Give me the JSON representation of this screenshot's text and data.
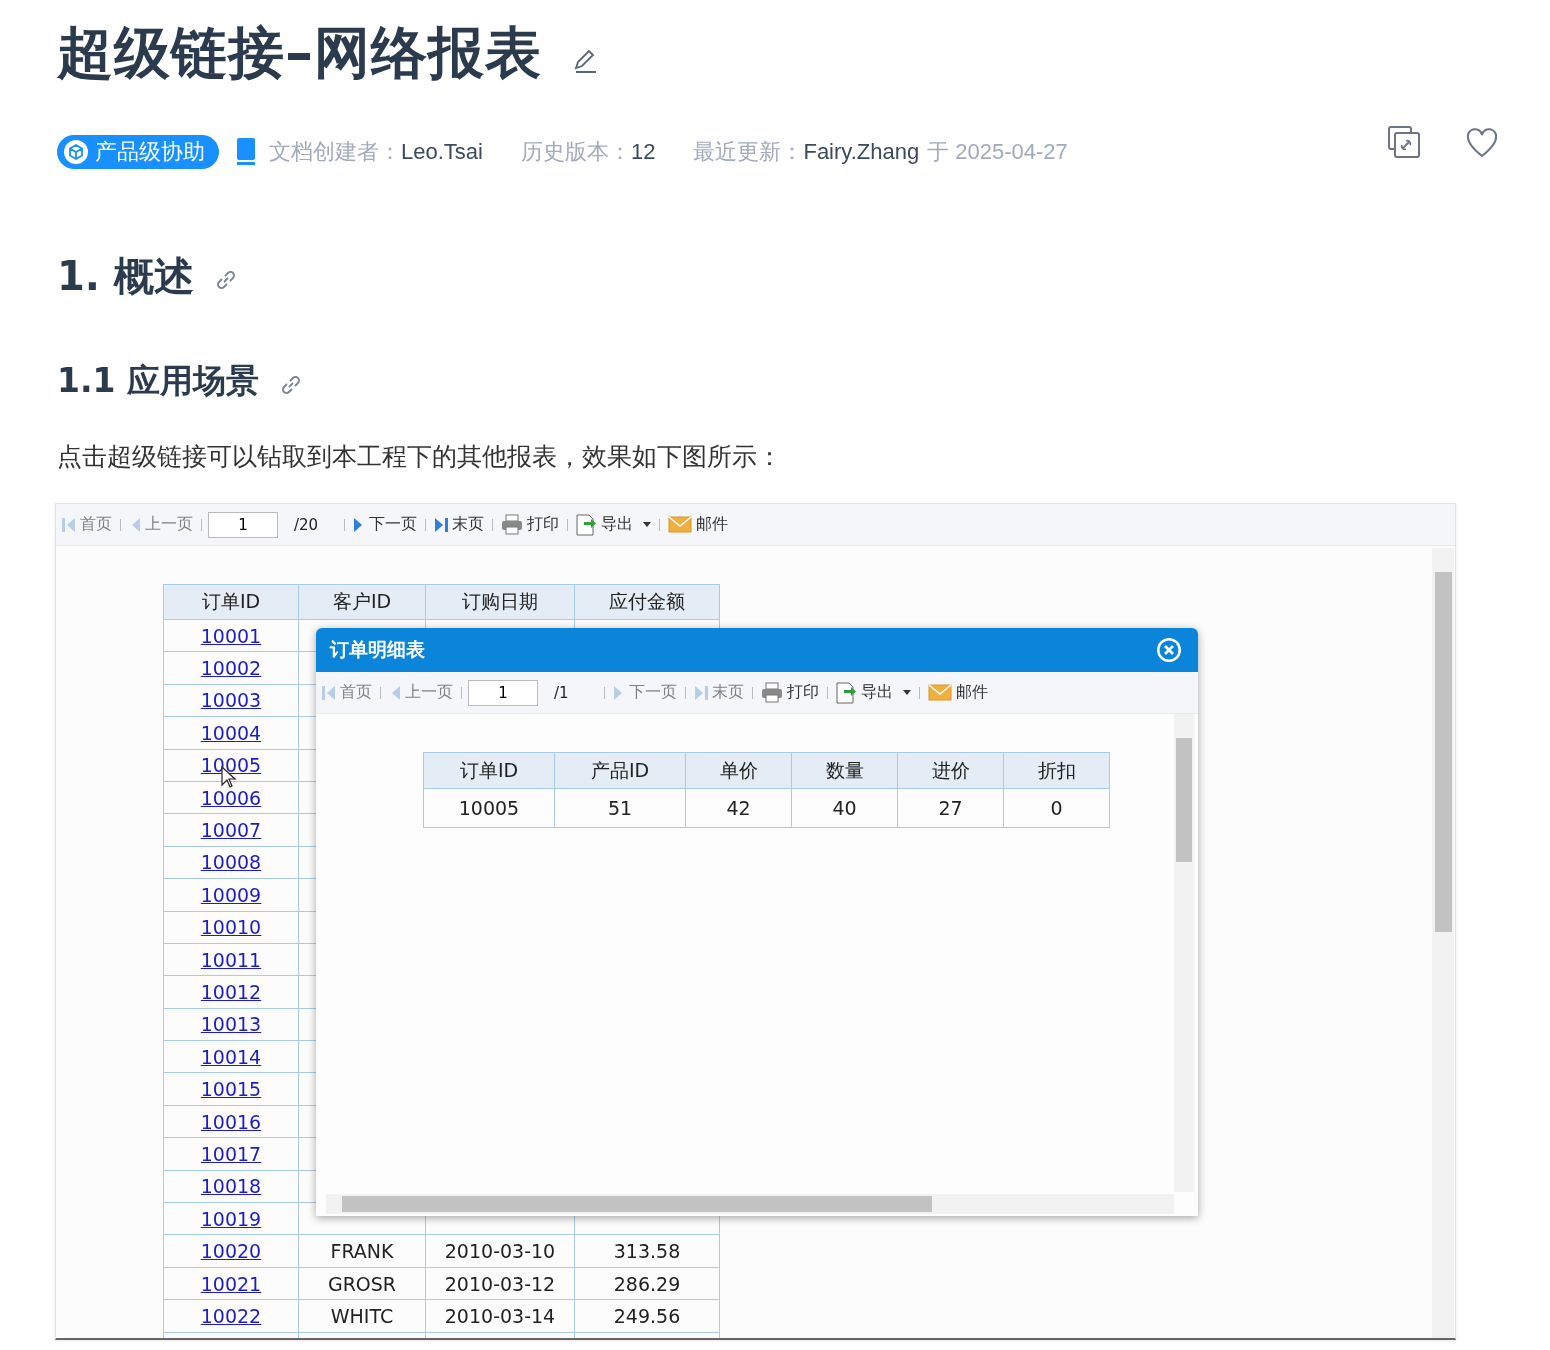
{
  "title": "超级链接–网络报表",
  "meta": {
    "badge": "产品级协助",
    "creator_label": "文档创建者：",
    "creator": "Leo.Tsai",
    "version_label": "历史版本：",
    "version": "12",
    "updated_label": "最近更新：",
    "updated_by": "Fairy.Zhang",
    "updated_date": "于 2025-04-27",
    "liked": false
  },
  "sections": [
    {
      "kind": "h2",
      "text": "1. 概述"
    },
    {
      "kind": "h3",
      "text": "1.1 应用场景"
    },
    {
      "kind": "paragraph",
      "text": "点击超级链接可以钻取到本工程下的其他报表，效果如下图所示："
    }
  ],
  "report": {
    "toolbar": [
      {
        "kind": "first",
        "label": "首页",
        "disabled": true
      },
      {
        "kind": "prev",
        "label": "上一页",
        "disabled": true
      },
      {
        "kind": "page",
        "value": "1",
        "total": "/20"
      },
      {
        "kind": "next",
        "label": "下一页",
        "disabled": false
      },
      {
        "kind": "last",
        "label": "末页",
        "disabled": false
      },
      {
        "kind": "print",
        "label": "打印",
        "disabled": false
      },
      {
        "kind": "export",
        "label": "导出",
        "disabled": false
      },
      {
        "kind": "mail",
        "label": "邮件",
        "disabled": false
      }
    ],
    "table": {
      "columns": [
        "订单ID",
        "客户ID",
        "订购日期",
        "应付金额"
      ],
      "rows": [
        {
          "id": "10001"
        },
        {
          "id": "10002"
        },
        {
          "id": "10003"
        },
        {
          "id": "10004"
        },
        {
          "id": "10005"
        },
        {
          "id": "10006"
        },
        {
          "id": "10007"
        },
        {
          "id": "10008"
        },
        {
          "id": "10009"
        },
        {
          "id": "10010"
        },
        {
          "id": "10011"
        },
        {
          "id": "10012"
        },
        {
          "id": "10013"
        },
        {
          "id": "10014"
        },
        {
          "id": "10015"
        },
        {
          "id": "10016"
        },
        {
          "id": "10017"
        },
        {
          "id": "10018"
        },
        {
          "id": "10019"
        },
        {
          "id": "10020",
          "customer": "FRANK",
          "date": "2010-03-10",
          "amount": "313.58"
        },
        {
          "id": "10021",
          "customer": "GROSR",
          "date": "2010-03-12",
          "amount": "286.29"
        },
        {
          "id": "10022",
          "customer": "WHITC",
          "date": "2010-03-14",
          "amount": "249.56"
        }
      ]
    },
    "popup": {
      "title": "订单明细表",
      "toolbar": [
        {
          "kind": "first",
          "label": "首页",
          "disabled": true
        },
        {
          "kind": "prev",
          "label": "上一页",
          "disabled": true
        },
        {
          "kind": "page",
          "value": "1",
          "total": "/1"
        },
        {
          "kind": "next",
          "label": "下一页",
          "disabled": true
        },
        {
          "kind": "last",
          "label": "末页",
          "disabled": true
        },
        {
          "kind": "print",
          "label": "打印",
          "disabled": false
        },
        {
          "kind": "export",
          "label": "导出",
          "disabled": false
        },
        {
          "kind": "mail",
          "label": "邮件",
          "disabled": false
        }
      ],
      "table": {
        "columns": [
          "订单ID",
          "产品ID",
          "单价",
          "数量",
          "进价",
          "折扣"
        ],
        "rows": [
          [
            "10005",
            "51",
            "42",
            "40",
            "27",
            "0"
          ]
        ]
      }
    }
  }
}
